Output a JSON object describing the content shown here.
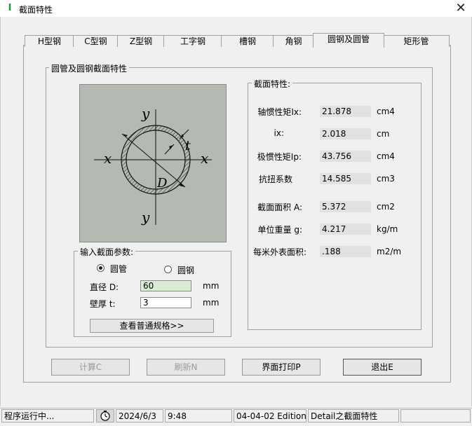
{
  "window": {
    "title": "截面特性",
    "close_glyph": "✕"
  },
  "tabs": [
    {
      "label": "H型钢"
    },
    {
      "label": "C型钢"
    },
    {
      "label": "Z型钢"
    },
    {
      "label": "工字钢"
    },
    {
      "label": "槽钢"
    },
    {
      "label": "角钢"
    },
    {
      "label": "圆钢及圆管"
    },
    {
      "label": "矩形管"
    }
  ],
  "active_tab": "圆钢及圆管",
  "section_group": {
    "title": "圆管及圆钢截面特性"
  },
  "figure": {
    "x_left": "x",
    "x_right": "x",
    "y_top": "y",
    "y_bottom": "y",
    "t": "t",
    "d": "D"
  },
  "input_group": {
    "title": "输入截面参数:",
    "radio_tube": "圆管",
    "radio_bar": "圆钢",
    "selected": "圆管",
    "diameter_label": "直径 D:",
    "diameter_value": "60",
    "diameter_unit": "mm",
    "thickness_label": "壁厚 t:",
    "thickness_value": "3",
    "thickness_unit": "mm",
    "spec_button": "查看普通规格>>"
  },
  "props_group": {
    "title": "截面特性:",
    "rows": [
      {
        "label": "轴惯性矩Ix:",
        "value": "21.878",
        "unit": "cm4"
      },
      {
        "label": "ix:",
        "value": "2.018",
        "unit": "cm"
      },
      {
        "label": "极惯性矩Ip:",
        "value": "43.756",
        "unit": "cm4"
      },
      {
        "label": "抗扭系数",
        "value": "14.585",
        "unit": "cm3"
      },
      {
        "label": "截面面积 A:",
        "value": "5.372",
        "unit": "cm2"
      },
      {
        "label": "单位重量 g:",
        "value": "4.217",
        "unit": "kg/m"
      },
      {
        "label": "每米外表面积:",
        "value": ".188",
        "unit": "m2/m"
      }
    ]
  },
  "buttons": {
    "calc": "计算C",
    "refresh": "刷新N",
    "print": "界面打印P",
    "exit": "退出E"
  },
  "status": {
    "running": "程序运行中...",
    "date": "2024/6/3",
    "time": "9:48",
    "edition": "04-04-02 Edition",
    "detail": "Detail之截面特性"
  },
  "colors": {
    "figure_bg": "#b4bab2",
    "input_highlight": "#d9ecd4",
    "value_bg": "#e1e1e1"
  }
}
